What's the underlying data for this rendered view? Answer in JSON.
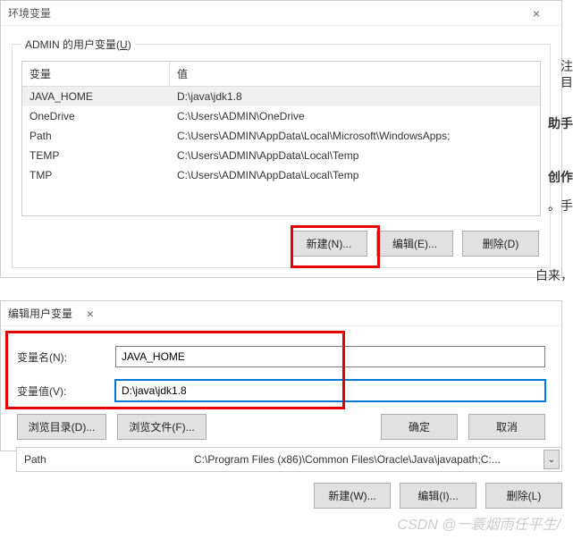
{
  "dialog1": {
    "title": "环境变量",
    "close": "×",
    "group_label": "ADMIN 的用户变量",
    "group_key": "U",
    "headers": {
      "var": "变量",
      "val": "值"
    },
    "rows": [
      {
        "var": "JAVA_HOME",
        "val": "D:\\java\\jdk1.8",
        "selected": true
      },
      {
        "var": "OneDrive",
        "val": "C:\\Users\\ADMIN\\OneDrive",
        "selected": false
      },
      {
        "var": "Path",
        "val": "C:\\Users\\ADMIN\\AppData\\Local\\Microsoft\\WindowsApps;",
        "selected": false
      },
      {
        "var": "TEMP",
        "val": "C:\\Users\\ADMIN\\AppData\\Local\\Temp",
        "selected": false
      },
      {
        "var": "TMP",
        "val": "C:\\Users\\ADMIN\\AppData\\Local\\Temp",
        "selected": false
      }
    ],
    "buttons": {
      "new": "新建(N)...",
      "edit": "编辑(E)...",
      "delete": "删除(D)"
    }
  },
  "dialog2": {
    "title": "编辑用户变量",
    "close": "×",
    "name_label": "变量名(N):",
    "name_value": "JAVA_HOME",
    "value_label": "变量值(V):",
    "value_value": "D:\\java\\jdk1.8",
    "buttons": {
      "browse_dir": "浏览目录(D)...",
      "browse_file": "浏览文件(F)...",
      "ok": "确定",
      "cancel": "取消"
    }
  },
  "bottom": {
    "row": {
      "var": "Path",
      "val": "C:\\Program Files (x86)\\Common Files\\Oracle\\Java\\javapath;C:..."
    },
    "buttons": {
      "new": "新建(W)...",
      "edit": "编辑(I)...",
      "delete": "删除(L)"
    }
  },
  "side": {
    "t1": "注",
    "t2": "目",
    "t3": "助手",
    "t4": "创作",
    "t5": "。手",
    "t6": "白来，"
  },
  "watermark": "CSDN @一蓑烟雨任平生/"
}
